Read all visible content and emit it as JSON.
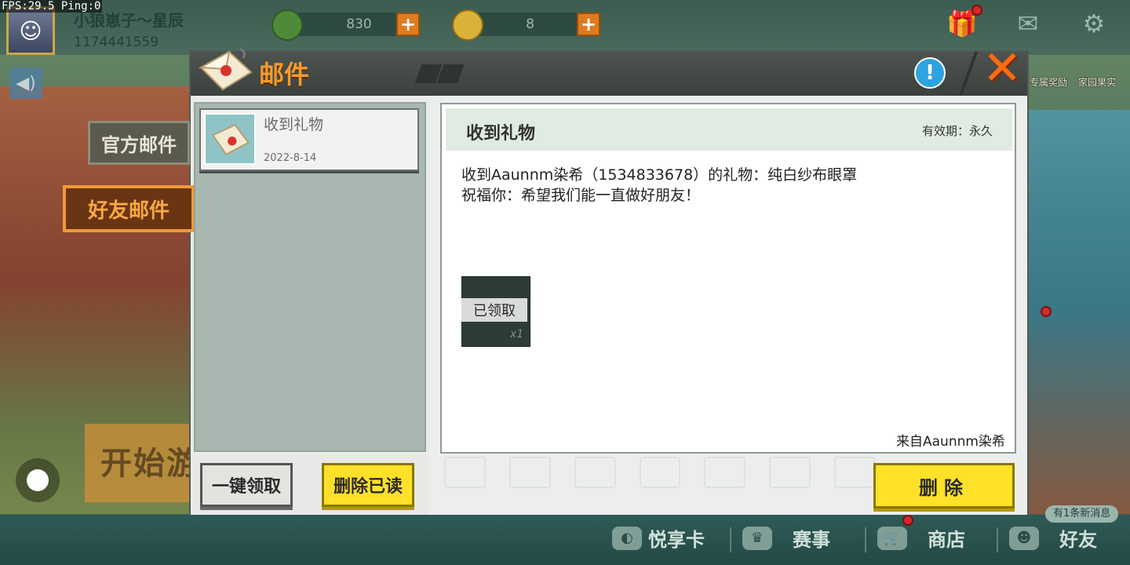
{
  "debug": {
    "fps_text": "FPS:29.5  Ping:0"
  },
  "user": {
    "name": "小狼崽子～星辰",
    "id": "1174441559"
  },
  "currency": [
    {
      "icon": "gem-coin-icon",
      "value": "830",
      "color": "#4f8a3a"
    },
    {
      "icon": "gold-coin-icon",
      "value": "8",
      "color": "#d9b23a"
    }
  ],
  "top_icons": [
    "gift-icon",
    "mail-icon",
    "settings-icon"
  ],
  "side_rewards": {
    "left": "专属奖励",
    "right": "家园果实"
  },
  "background": {
    "start_text": "开始游"
  },
  "dialog": {
    "title": "邮件",
    "info_symbol": "!",
    "close_symbol": "✕",
    "tabs": {
      "official": "官方邮件",
      "friend": "好友邮件"
    },
    "list": [
      {
        "title": "收到礼物",
        "date": "2022-8-14"
      }
    ],
    "buttons": {
      "claim_all": "一键领取",
      "delete_read": "删除已读",
      "delete": "删除"
    },
    "mail": {
      "title": "收到礼物",
      "expiry": "有效期：永久",
      "body_line1": "收到Aaunnm染希（1534833678）的礼物：纯白纱布眼罩",
      "body_line2": "祝福你：希望我们能一直做好朋友！",
      "attachment_status": "已领取",
      "attachment_qty": "x1",
      "from": "来自Aaunnm染希"
    }
  },
  "bottom_nav": {
    "items": [
      {
        "label": "悦享卡",
        "icon": "pig-icon"
      },
      {
        "label": "赛事",
        "icon": "trophy-icon"
      },
      {
        "label": "商店",
        "icon": "cart-icon"
      },
      {
        "label": "好友",
        "icon": "friend-icon"
      }
    ],
    "message_pill": "有1条新消息"
  },
  "colors": {
    "accent_orange": "#f29a2e",
    "button_yellow": "#ffe12a",
    "info_blue": "#2ea3df"
  }
}
